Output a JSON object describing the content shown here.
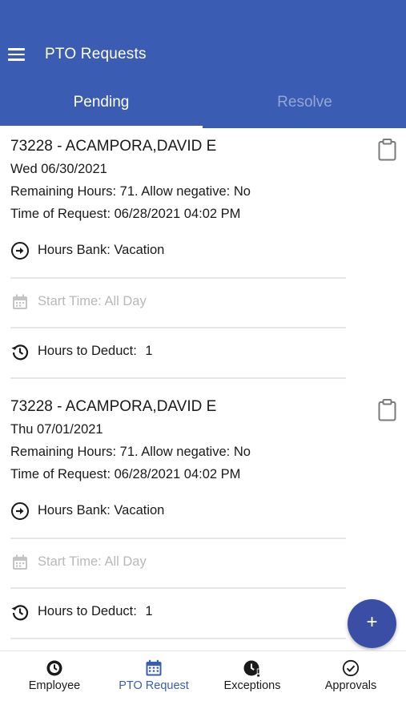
{
  "app_bar": {
    "title": "PTO Requests",
    "menu_icon": "hamburger-menu-icon",
    "color": "#3b5cb3"
  },
  "tabs": [
    {
      "label": "Pending",
      "selected": true
    },
    {
      "label": "Resolve",
      "selected": false
    }
  ],
  "requests": [
    {
      "employee": "73228 - ACAMPORA,DAVID E",
      "date": "Wed 06/30/2021",
      "remaining": "Remaining Hours: 71. Allow negative: No",
      "time_of_request": "Time of Request: 06/28/2021 04:02 PM",
      "hours_bank": "Hours Bank: Vacation",
      "start_time_placeholder": "Start Time: All Day",
      "hours_to_deduct_label": "Hours to Deduct:",
      "hours_to_deduct_value": "1"
    },
    {
      "employee": "73228 - ACAMPORA,DAVID E",
      "date": "Thu 07/01/2021",
      "remaining": "Remaining Hours: 71. Allow negative: No",
      "time_of_request": "Time of Request: 06/28/2021 04:02 PM",
      "hours_bank": "Hours Bank: Vacation",
      "start_time_placeholder": "Start Time: All Day",
      "hours_to_deduct_label": "Hours to Deduct:",
      "hours_to_deduct_value": "1"
    }
  ],
  "fab": {
    "label": "+",
    "color": "#3b4ea6"
  },
  "bottom_nav": [
    {
      "label": "Employee",
      "icon": "clock-badge-icon",
      "active": false
    },
    {
      "label": "PTO Request",
      "icon": "calendar-icon",
      "active": true
    },
    {
      "label": "Exceptions",
      "icon": "clock-alert-icon",
      "active": false
    },
    {
      "label": "Approvals",
      "icon": "check-circle-icon",
      "active": false
    }
  ]
}
